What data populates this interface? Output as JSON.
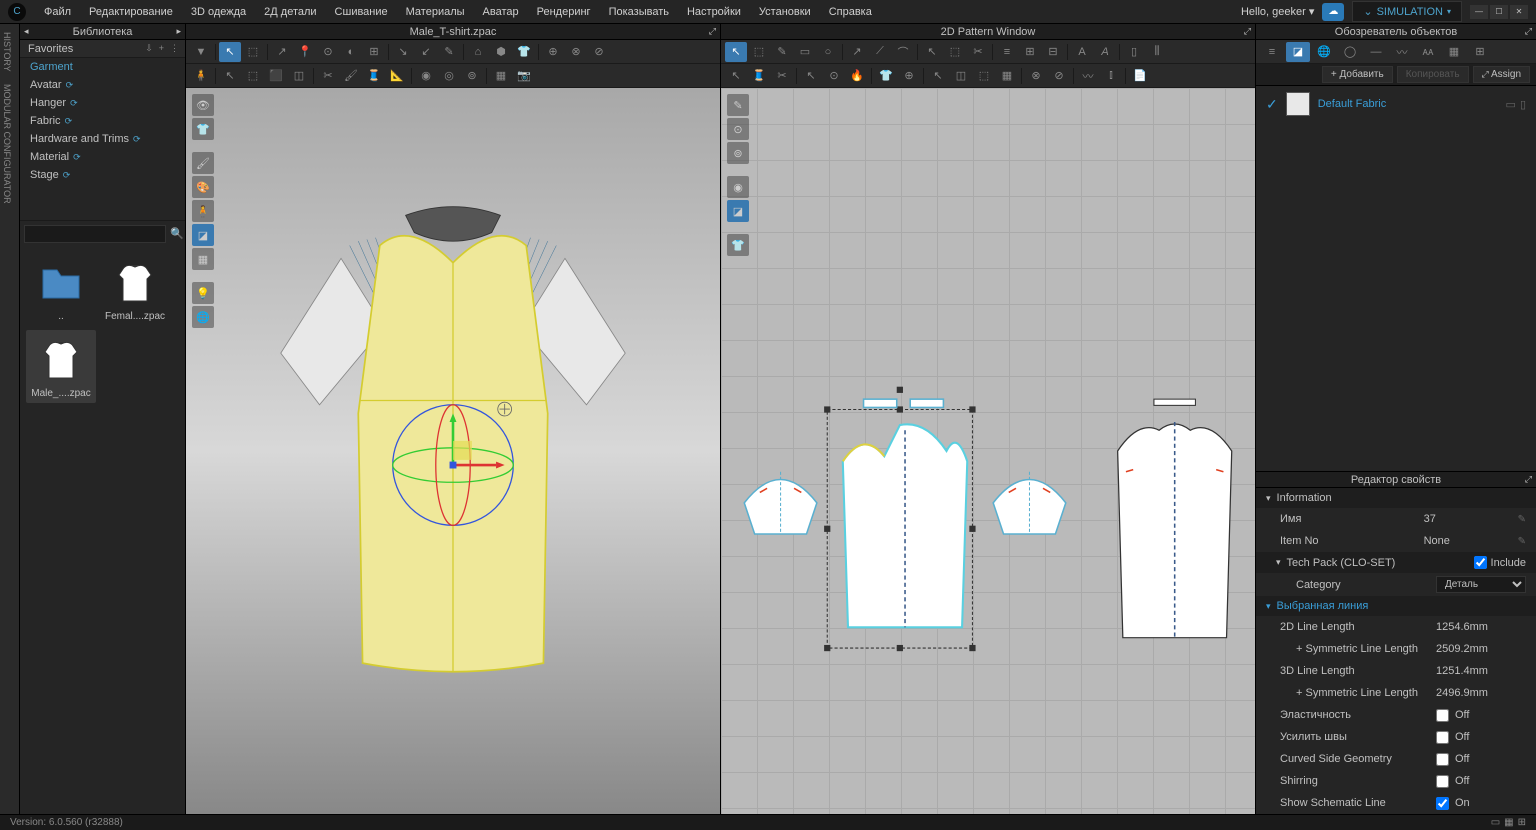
{
  "menu": [
    "Файл",
    "Редактирование",
    "3D одежда",
    "2Д детали",
    "Сшивание",
    "Материалы",
    "Аватар",
    "Рендеринг",
    "Показывать",
    "Настройки",
    "Установки",
    "Справка"
  ],
  "hello": "Hello, geeker",
  "simulation": "SIMULATION",
  "left_tabs": [
    "HISTORY",
    "MODULAR CONFIGURATOR"
  ],
  "library": {
    "title": "Библиотека",
    "favorites": "Favorites",
    "items": [
      {
        "label": "Garment",
        "active": true,
        "refresh": false
      },
      {
        "label": "Avatar",
        "active": false,
        "refresh": true
      },
      {
        "label": "Hanger",
        "active": false,
        "refresh": true
      },
      {
        "label": "Fabric",
        "active": false,
        "refresh": true
      },
      {
        "label": "Hardware and Trims",
        "active": false,
        "refresh": true
      },
      {
        "label": "Material",
        "active": false,
        "refresh": true
      },
      {
        "label": "Stage",
        "active": false,
        "refresh": true
      }
    ],
    "thumbs": [
      {
        "label": "..",
        "type": "folder"
      },
      {
        "label": "Femal....zpac",
        "type": "shirt"
      },
      {
        "label": "Male_....zpac",
        "type": "shirt",
        "selected": true
      }
    ]
  },
  "viewport3d": {
    "title": "Male_T-shirt.zpac"
  },
  "viewport2d": {
    "title": "2D Pattern Window"
  },
  "object_browser": {
    "title": "Обозреватель объектов",
    "add": "+ Добавить",
    "copy": "Копировать",
    "assign": "Assign",
    "fabric": "Default Fabric"
  },
  "property_editor": {
    "title": "Редактор свойств",
    "info": "Information",
    "name_label": "Имя",
    "name_value": "37",
    "itemno_label": "Item No",
    "itemno_value": "None",
    "techpack_label": "Tech Pack (CLO-SET)",
    "techpack_value": "Include",
    "category_label": "Category",
    "category_value": "Деталь",
    "selected_line": "Выбранная линия",
    "len2d_label": "2D Line Length",
    "len2d_value": "1254.6mm",
    "sym2d_label": "+ Symmetric Line Length",
    "sym2d_value": "2509.2mm",
    "len3d_label": "3D Line Length",
    "len3d_value": "1251.4mm",
    "sym3d_label": "+ Symmetric Line Length",
    "sym3d_value": "2496.9mm",
    "elastic_label": "Эластичность",
    "elastic_value": "Off",
    "seam_label": "Усилить швы",
    "seam_value": "Off",
    "curved_label": "Curved Side Geometry",
    "curved_value": "Off",
    "shirring_label": "Shirring",
    "shirring_value": "Off",
    "schematic_label": "Show Schematic Line",
    "schematic_value": "On"
  },
  "status": "Version: 6.0.560 (r32888)"
}
